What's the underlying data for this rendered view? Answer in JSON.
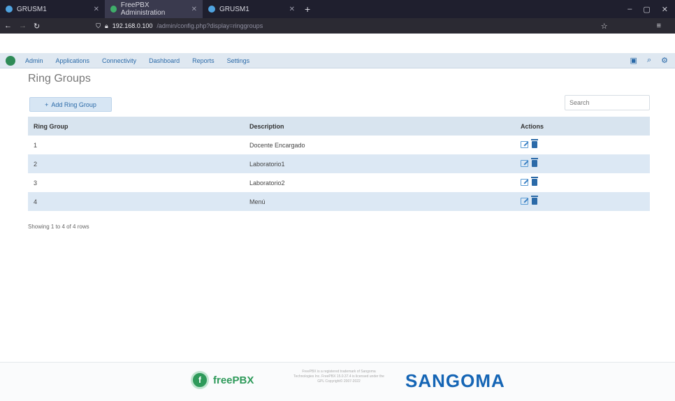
{
  "browser": {
    "tabs": [
      {
        "label": "GRUSM1"
      },
      {
        "label": "FreePBX Administration"
      },
      {
        "label": "GRUSM1"
      }
    ],
    "new_tab": "+",
    "url_host": "192.168.0.100",
    "url_path": "/admin/config.php?display=ringgroups",
    "window_controls": [
      "–",
      "▢",
      "✕"
    ]
  },
  "nav": {
    "items": [
      "Admin",
      "Applications",
      "Connectivity",
      "Dashboard",
      "Reports",
      "Settings"
    ]
  },
  "page": {
    "title": "Ring Groups",
    "add_button": "Add Ring Group",
    "search_placeholder": "Search"
  },
  "table": {
    "headers": [
      "Ring Group",
      "Description",
      "Actions"
    ],
    "rows": [
      {
        "id": "1",
        "description": "Docente Encargado"
      },
      {
        "id": "2",
        "description": "Laboratorio1"
      },
      {
        "id": "3",
        "description": "Laboratorio2"
      },
      {
        "id": "4",
        "description": "Menú"
      }
    ],
    "footer": "Showing 1 to 4 of 4 rows"
  },
  "footer": {
    "freepbx": "freePBX",
    "sangoma": "SANGOMA",
    "legal": "FreePBX is a registered trademark of Sangoma Technologies Inc. FreePBX 15.0.37.4 is licensed under the GPL Copyright© 2007-2022"
  },
  "colors": {
    "nav_bg": "#dfe8f1",
    "table_header_bg": "#d8e4ef",
    "alt_row_bg": "#dce8f4",
    "link": "#2b6aa8",
    "freepbx_green": "#2e9a5a",
    "sangoma_blue": "#1565b5"
  }
}
